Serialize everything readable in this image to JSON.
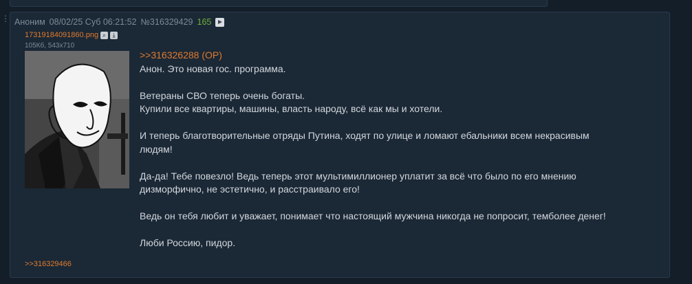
{
  "post": {
    "author": "Аноним",
    "date": "08/02/25 Суб 06:21:52",
    "number": "№316329429",
    "count": "165",
    "file": {
      "name": "17319184091860.png",
      "meta": "105Кб, 543x710"
    },
    "reply_link": ">>316326288 (OP)",
    "paragraphs": [
      "Анон. Это новая гос. программа.",
      "",
      "Ветераны СВО теперь очень богаты.",
      "Купили все квартиры, машины, власть народу, всё как мы и хотели.",
      "",
      "И теперь благотворительные отряды Путина, ходят по улице и ломают ебальники всем некрасивым",
      "людям!",
      "",
      "Да-да! Тебе повезло! Ведь теперь этот мультимиллионер уплатит за всё что было по его мнению",
      "дизморфично, не эстетично, и расстраивало его!",
      "",
      "Ведь он тебя любит и уважает, понимает что настоящий мужчина никогда не попросит, темболее денег!",
      "",
      "Люби Россию, пидор."
    ],
    "backlink": ">>316329466"
  },
  "icons": {
    "play": "play-icon",
    "search": "search-icon",
    "download": "download-icon"
  },
  "colors": {
    "background": "#141e29",
    "post_bg": "#1b2836",
    "accent_link": "#e07b2e",
    "count": "#6fb23a",
    "text": "#d3d8dd",
    "meta": "#7d8b98"
  }
}
